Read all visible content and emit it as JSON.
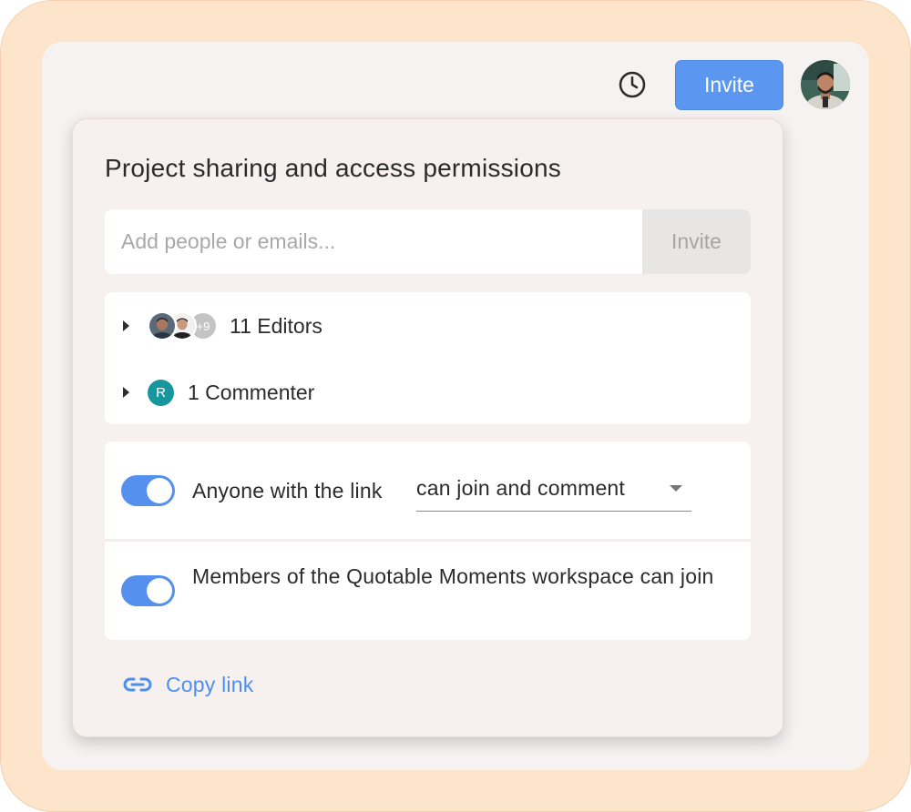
{
  "header": {
    "history_icon": "clock-icon",
    "invite_label": "Invite",
    "avatar_icon": "user-avatar"
  },
  "share_panel": {
    "title": "Project sharing and access permissions",
    "invite_input": {
      "placeholder": "Add people or emails...",
      "value": ""
    },
    "invite_button_label": "Invite",
    "members": [
      {
        "label": "11 Editors",
        "extra_count": "+9",
        "expand_icon": "caret-right-icon"
      },
      {
        "label": "1 Commenter",
        "initial": "R",
        "expand_icon": "caret-right-icon"
      }
    ],
    "settings": [
      {
        "enabled": true,
        "text_prefix": "Anyone with the link",
        "dropdown_value": "can join and comment"
      },
      {
        "enabled": true,
        "text": "Members of the Quotable Moments workspace can join"
      }
    ],
    "copy_link_label": "Copy link"
  },
  "colors": {
    "accent": "#5b96f1",
    "frame": "#fde5cc",
    "commenter_avatar": "#17969d"
  }
}
